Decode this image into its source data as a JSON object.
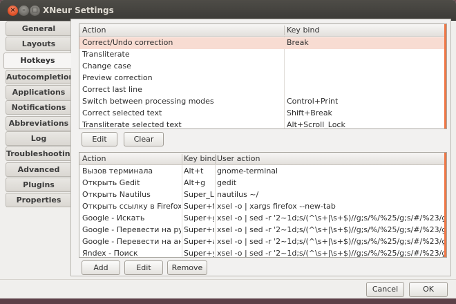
{
  "window": {
    "title": "XNeur Settings"
  },
  "window_buttons": {
    "close": "×",
    "minimize": "–",
    "maximize": "□"
  },
  "sidebar": {
    "items": [
      {
        "label": "General"
      },
      {
        "label": "Layouts"
      },
      {
        "label": "Hotkeys"
      },
      {
        "label": "Autocompletion"
      },
      {
        "label": "Applications"
      },
      {
        "label": "Notifications"
      },
      {
        "label": "Abbreviations"
      },
      {
        "label": "Log"
      },
      {
        "label": "Troubleshooting"
      },
      {
        "label": "Advanced"
      },
      {
        "label": "Plugins"
      },
      {
        "label": "Properties"
      }
    ],
    "active": "Hotkeys"
  },
  "actions_table": {
    "headers": [
      "Action",
      "Key bind"
    ],
    "rows": [
      {
        "action": "Correct/Undo correction",
        "key": "Break",
        "selected": true
      },
      {
        "action": "Transliterate",
        "key": ""
      },
      {
        "action": "Change case",
        "key": ""
      },
      {
        "action": "Preview correction",
        "key": ""
      },
      {
        "action": "Correct last line",
        "key": ""
      },
      {
        "action": "Switch between processing modes",
        "key": "Control+Print"
      },
      {
        "action": "Correct selected text",
        "key": "Shift+Break"
      },
      {
        "action": "Transliterate selected text",
        "key": "Alt+Scroll_Lock"
      }
    ]
  },
  "actions_buttons": {
    "edit": "Edit",
    "clear": "Clear"
  },
  "user_table": {
    "headers": [
      "Action",
      "Key bind",
      "User action"
    ],
    "rows": [
      {
        "action": "Вызов терминала",
        "key": "Alt+t",
        "user": "gnome-terminal"
      },
      {
        "action": "Открыть Gedit",
        "key": "Alt+g",
        "user": "gedit"
      },
      {
        "action": "Открыть Nautilus",
        "key": "Super_L",
        "user": "nautilus ~/"
      },
      {
        "action": "Открыть ссылку в Firefox",
        "key": "Super+f",
        "user": "xsel -o | xargs firefox --new-tab"
      },
      {
        "action": "Google - Искать",
        "key": "Super+g",
        "user": "xsel -o | sed -r '2~1d;s/(^\\s+|\\s+$)//g;s/%/%25/g;s/#/%23/g;s/\\$/%"
      },
      {
        "action": "Google - Перевести на русски",
        "key": "Super+r",
        "user": "xsel -o | sed -r '2~1d;s/(^\\s+|\\s+$)//g;s/%/%25/g;s/#/%23/g;s/\\$/%"
      },
      {
        "action": "Google - Перевести на англи",
        "key": "Super+a",
        "user": "xsel -o | sed -r '2~1d;s/(^\\s+|\\s+$)//g;s/%/%25/g;s/#/%23/g;s/\\$/%"
      },
      {
        "action": "Яndex - Поиск",
        "key": "Super+y",
        "user": "xsel -o | sed -r '2~1d;s/(^\\s+|\\s+$)//g;s/%/%25/g;s/#/%23/g;s/\\$/%"
      }
    ]
  },
  "user_buttons": {
    "add": "Add",
    "edit": "Edit",
    "remove": "Remove"
  },
  "dialog_buttons": {
    "cancel": "Cancel",
    "ok": "OK"
  },
  "colors": {
    "accent": "#f07746",
    "selection": "#f8dcd2",
    "titlebar": "#3c3b37"
  }
}
